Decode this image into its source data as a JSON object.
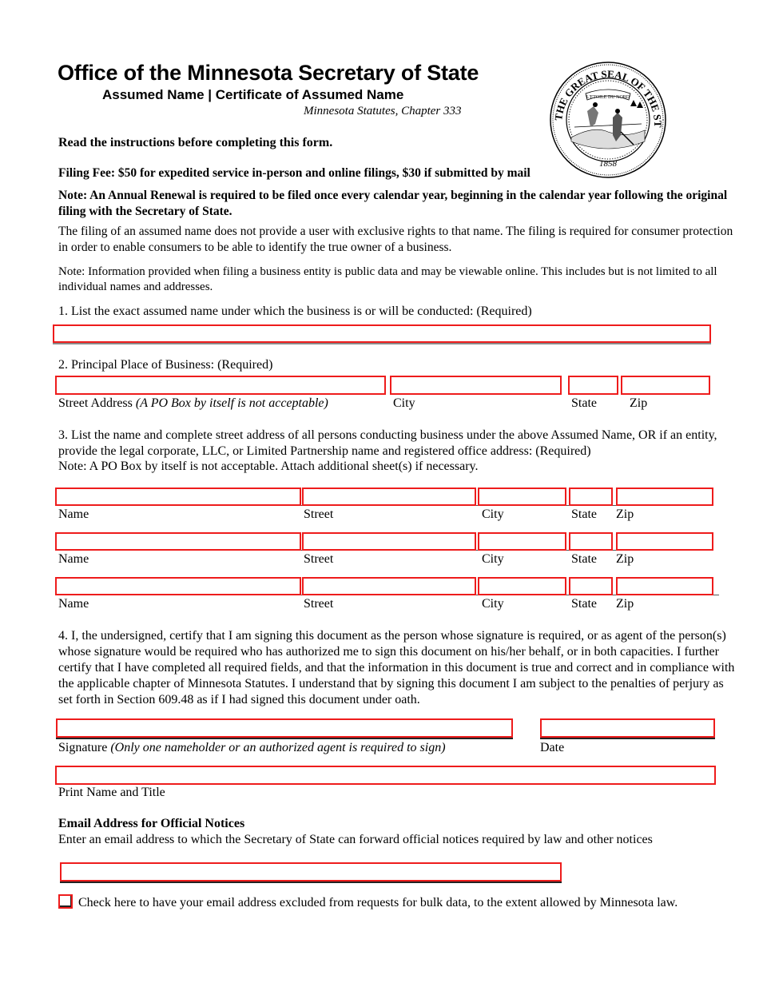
{
  "header": {
    "title": "Office of the Minnesota Secretary of State",
    "subtitle": "Assumed Name | Certificate of Assumed Name",
    "statute": "Minnesota Statutes, Chapter 333",
    "seal": {
      "outer_text": "THE GREAT SEAL OF THE STATE OF MINNESOTA",
      "banner_text": "L'ETOILE DU NORD",
      "year": "1858"
    }
  },
  "intro": {
    "read_instructions": "Read the instructions before completing this form.",
    "filing_fee": "Filing Fee: $50 for expedited service in-person and online filings, $30 if submitted by mail",
    "annual_note": "Note:  An Annual Renewal is required to be filed once every calendar year, beginning in the calendar year following the original filing with the Secretary of State.",
    "rights_text": "The filing of an assumed name does not provide a user with exclusive rights to that name. The filing is required for consumer protection in order to enable consumers to be able to identify the true owner of a business.",
    "public_data_note": "Note: Information provided when filing a business entity is public data and may be viewable online. This includes but is not limited to all individual names and addresses."
  },
  "section1": {
    "question": "1. List the exact assumed name under which the business is or will be conducted: (Required)",
    "value": ""
  },
  "section2": {
    "question": "2. Principal Place of Business: (Required)",
    "labels": {
      "street": "Street Address",
      "street_note": "(A PO Box by itself is not acceptable)",
      "city": "City",
      "state": "State",
      "zip": "Zip"
    },
    "values": {
      "street": "",
      "city": "",
      "state": "",
      "zip": ""
    }
  },
  "section3": {
    "question": "3. List the name and complete street address of all persons conducting business under the above Assumed Name, OR if an entity, provide the legal corporate, LLC, or Limited Partnership name and registered office address: (Required)",
    "note": "Note: A PO Box by itself is not acceptable.  Attach additional sheet(s) if necessary.",
    "labels": {
      "name": "Name",
      "street": "Street",
      "city": "City",
      "state": "State",
      "zip": "Zip"
    },
    "rows": [
      {
        "name": "",
        "street": "",
        "city": "",
        "state": "",
        "zip": ""
      },
      {
        "name": "",
        "street": "",
        "city": "",
        "state": "",
        "zip": ""
      },
      {
        "name": "",
        "street": "",
        "city": "",
        "state": "",
        "zip": ""
      }
    ]
  },
  "section4": {
    "certification": "4. I, the undersigned, certify that I am signing this document as the person whose signature is required, or as agent of the person(s) whose signature would be required who has authorized me to sign this document on his/her behalf, or in both capacities.  I further certify that I have completed all required fields, and that the information in this document is true and correct and in compliance with the applicable chapter of Minnesota Statutes.  I understand that by signing this document I am subject to the penalties of perjury as set forth in Section 609.48 as if I had signed this document under oath.",
    "signature_label": "Signature",
    "signature_note": "(Only one nameholder or an authorized agent is required to sign)",
    "date_label": "Date",
    "print_name_label": "Print Name and Title",
    "values": {
      "signature": "",
      "date": "",
      "print_name": ""
    }
  },
  "email": {
    "heading": "Email Address for Official Notices",
    "description": "Enter an email address to which the Secretary of State can forward official notices required by law and other notices",
    "value": "",
    "exclude_label": "Check here to have your email address excluded from requests for bulk data, to the extent allowed by Minnesota law.",
    "exclude_checked": false
  },
  "colors": {
    "field_border": "#ee1c1c"
  }
}
